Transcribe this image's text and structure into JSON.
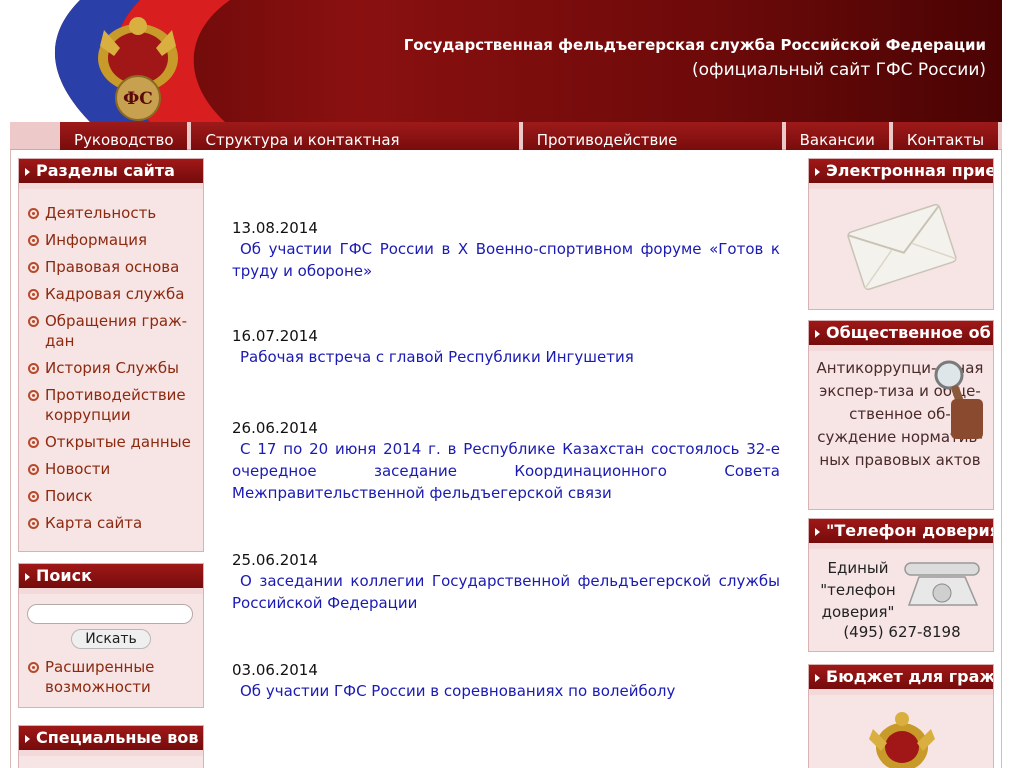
{
  "header": {
    "title": "Государственная фельдъегерская служба Российской Федерации",
    "subtitle": "(официальный сайт ГФС России)",
    "logo_text": "ФС",
    "flag_colors": [
      "#ffffff",
      "#2a3fa8",
      "#d81e1e"
    ]
  },
  "nav": {
    "tabs": [
      "Руководство",
      "Структура и контактная информация",
      "Противодействие коррупции",
      "Вакансии",
      "Контакты"
    ]
  },
  "sections": {
    "title": "Разделы сайта",
    "items": [
      "Деятельность",
      "Информация",
      "Правовая основа",
      "Кадровая служба",
      "Обращения граж-\nдан",
      "История Службы",
      "Противодействие коррупции",
      "Открытые данные",
      "Новости",
      "Поиск",
      "Карта сайта"
    ]
  },
  "search": {
    "title": "Поиск",
    "placeholder": "",
    "button": "Искать",
    "advanced": "Расширенные возможности"
  },
  "special": {
    "title": "Специальные вов"
  },
  "news": [
    {
      "date": "13.08.2014",
      "text": "Об участии ГФС России в X Военно-спортивном форуме «Готов к труду и обороне»"
    },
    {
      "date": "16.07.2014",
      "text": "Рабочая встреча с главой Республики Ингушетия"
    },
    {
      "date": "26.06.2014",
      "text": "С 17 по 20 июня 2014 г. в Республике Казахстан состоялось 32-е очередное заседание Координационного Совета Межправительственной фельдъегерской связи"
    },
    {
      "date": "25.06.2014",
      "text": "О заседании коллегии Государственной фельдъегерской службы Российской Федерации"
    },
    {
      "date": "03.06.2014",
      "text": "Об участии ГФС России в соревнованиях по волейболу"
    }
  ],
  "right": {
    "reception_title": "Электронная прие",
    "discussion_title": "Общественное об",
    "discussion_text": "Антикоррупци-онная экспер-тиза и обще-ственное об-суждение норматив-ных правовых актов",
    "hotline_title": "\"Телефон доверия",
    "hotline_text": "Единый \"телефон доверия\"",
    "hotline_phone": "(495) 627-8198",
    "budget_title": "Бюджет для граж"
  },
  "colors": {
    "header_red": "#7a0c0c",
    "panel_pink": "#f7e4e4",
    "link_blue": "#1a1ab4",
    "menu_link": "#8c2a10"
  }
}
